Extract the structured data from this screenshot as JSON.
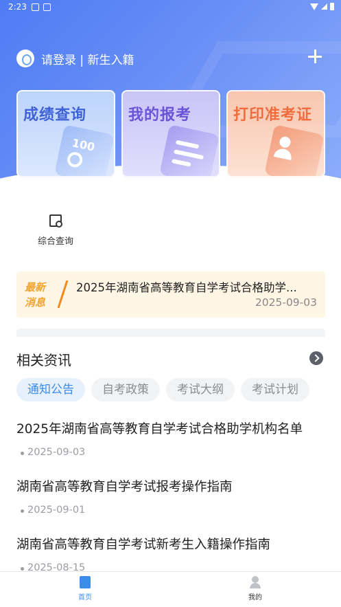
{
  "status_bar": {
    "time": "2:23"
  },
  "header": {
    "login_text": "请登录 | 新生入籍"
  },
  "feature_cards": [
    {
      "title": "成绩查询",
      "art_text": "100",
      "color": "#3f63d6"
    },
    {
      "title": "我的报考",
      "color": "#6b53d8"
    },
    {
      "title": "打印准考证",
      "color": "#ee6c3e"
    }
  ],
  "quick_actions": [
    {
      "label": "综合查询"
    }
  ],
  "ticker": {
    "badge_line1": "最新",
    "badge_line2": "消息",
    "text": "2025年湖南省高等教育自学考试合格助学...",
    "date": "2025-09-03"
  },
  "section": {
    "title": "相关资讯"
  },
  "tabs": [
    {
      "label": "通知公告",
      "active": true
    },
    {
      "label": "自考政策"
    },
    {
      "label": "考试大纲"
    },
    {
      "label": "考试计划"
    }
  ],
  "news": [
    {
      "title": "2025年湖南省高等教育自学考试合格助学机构名单",
      "date": "2025-09-03"
    },
    {
      "title": "湖南省高等教育自学考试报考操作指南",
      "date": "2025-09-01"
    },
    {
      "title": "湖南省高等教育自学考试新考生入籍操作指南",
      "date": "2025-08-15"
    }
  ],
  "bottom_nav": [
    {
      "label": "首页",
      "active": true
    },
    {
      "label": "我的"
    }
  ],
  "colors": {
    "primary": "#3b8ce8",
    "hero": "#4d7cf4",
    "ticker_bg": "#fff6e6",
    "ticker_accent": "#f0a431"
  }
}
